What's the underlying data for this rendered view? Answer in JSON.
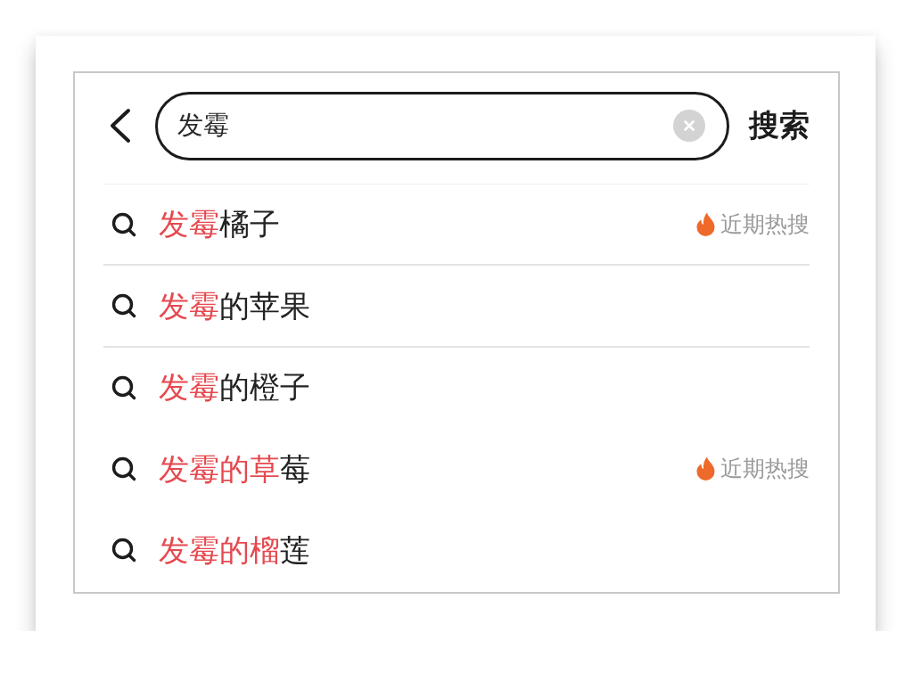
{
  "search_bar": {
    "value": "发霉",
    "button": "搜索"
  },
  "suggestions": [
    {
      "highlight": "发霉",
      "text": "橘子",
      "tag": "近期热搜",
      "divider": true
    },
    {
      "highlight": "发霉",
      "text": "的苹果",
      "divider": true
    },
    {
      "highlight": "发霉",
      "text": "的橙子",
      "divider": false
    },
    {
      "highlight": "发霉的草",
      "text": "莓",
      "tag": "近期热搜",
      "divider": false
    },
    {
      "highlight": "发霉的榴",
      "text": "莲",
      "divider": false
    }
  ]
}
